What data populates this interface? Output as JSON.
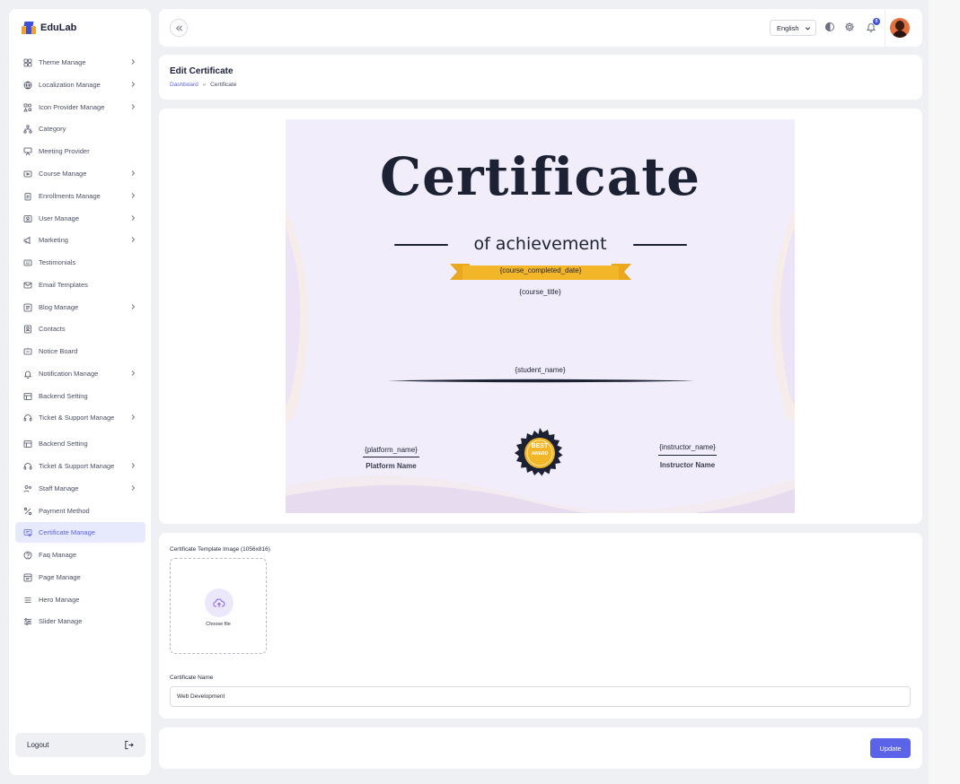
{
  "brand": {
    "name": "EduLab"
  },
  "sidebar": {
    "items": [
      {
        "label": "Theme Manage",
        "icon": "grid-icon",
        "has_submenu": true
      },
      {
        "label": "Localization Manage",
        "icon": "globe-icon",
        "has_submenu": true
      },
      {
        "label": "Icon Provider Manage",
        "icon": "icons-icon",
        "has_submenu": true
      },
      {
        "label": "Category",
        "icon": "hierarchy-icon",
        "has_submenu": false
      },
      {
        "label": "Meeting Provider",
        "icon": "meeting-icon",
        "has_submenu": false
      },
      {
        "label": "Course Manage",
        "icon": "video-icon",
        "has_submenu": true
      },
      {
        "label": "Enrollments Manage",
        "icon": "clipboard-icon",
        "has_submenu": true
      },
      {
        "label": "User Manage",
        "icon": "user-card-icon",
        "has_submenu": true
      },
      {
        "label": "Marketing",
        "icon": "megaphone-icon",
        "has_submenu": true
      },
      {
        "label": "Testimonials",
        "icon": "quote-icon",
        "has_submenu": false
      },
      {
        "label": "Email Templates",
        "icon": "mail-icon",
        "has_submenu": false
      },
      {
        "label": "Blog Manage",
        "icon": "blog-icon",
        "has_submenu": true
      },
      {
        "label": "Contacts",
        "icon": "contact-icon",
        "has_submenu": false
      },
      {
        "label": "Notice Board",
        "icon": "board-icon",
        "has_submenu": false
      },
      {
        "label": "Notification Manage",
        "icon": "bell-icon",
        "has_submenu": true
      },
      {
        "label": "Backend Setting",
        "icon": "settings-panel-icon",
        "has_submenu": false
      },
      {
        "label": "Ticket & Support Manage",
        "icon": "headset-icon",
        "has_submenu": true
      },
      {
        "label": "Backend Setting",
        "icon": "settings-panel-icon",
        "has_submenu": false
      },
      {
        "label": "Ticket & Support Manage",
        "icon": "headset-icon",
        "has_submenu": true
      },
      {
        "label": "Staff Manage",
        "icon": "staff-icon",
        "has_submenu": true
      },
      {
        "label": "Payment Method",
        "icon": "percent-icon",
        "has_submenu": false
      },
      {
        "label": "Certificate Manage",
        "icon": "certificate-icon",
        "has_submenu": false,
        "active": true
      },
      {
        "label": "Faq Manage",
        "icon": "question-icon",
        "has_submenu": false
      },
      {
        "label": "Page Manage",
        "icon": "page-icon",
        "has_submenu": false
      },
      {
        "label": "Hero Manage",
        "icon": "menu-lines-icon",
        "has_submenu": false
      },
      {
        "label": "Slider Manage",
        "icon": "slider-icon",
        "has_submenu": false
      }
    ],
    "logout_label": "Logout"
  },
  "topbar": {
    "language": "English",
    "notification_count": "0"
  },
  "page": {
    "title": "Edit Certificate",
    "breadcrumb": {
      "home": "Dashboard",
      "separator": "»",
      "current": "Certificate"
    }
  },
  "certificate": {
    "title": "Certificate",
    "subtitle": "of achievement",
    "course_completed_date": "{course_completed_date}",
    "course_title": "{course_title}",
    "student_name": "{student_name}",
    "platform_placeholder": "{platform_name}",
    "platform_label": "Platform Name",
    "instructor_placeholder": "{instructor_name}",
    "instructor_label": "Instructor Name",
    "seal_top": "BEST",
    "seal_bottom": "AWARD"
  },
  "form": {
    "template_label": "Certificate Template Image (1056x816)",
    "choose_file": "Choose file",
    "name_label": "Certificate Name",
    "name_value": "Web Development"
  },
  "actions": {
    "update_label": "Update"
  },
  "colors": {
    "accent": "#5b64e8",
    "ribbon": "#f4b629",
    "certificate_bg": "#f1edfb",
    "dark_text": "#1c2234"
  }
}
